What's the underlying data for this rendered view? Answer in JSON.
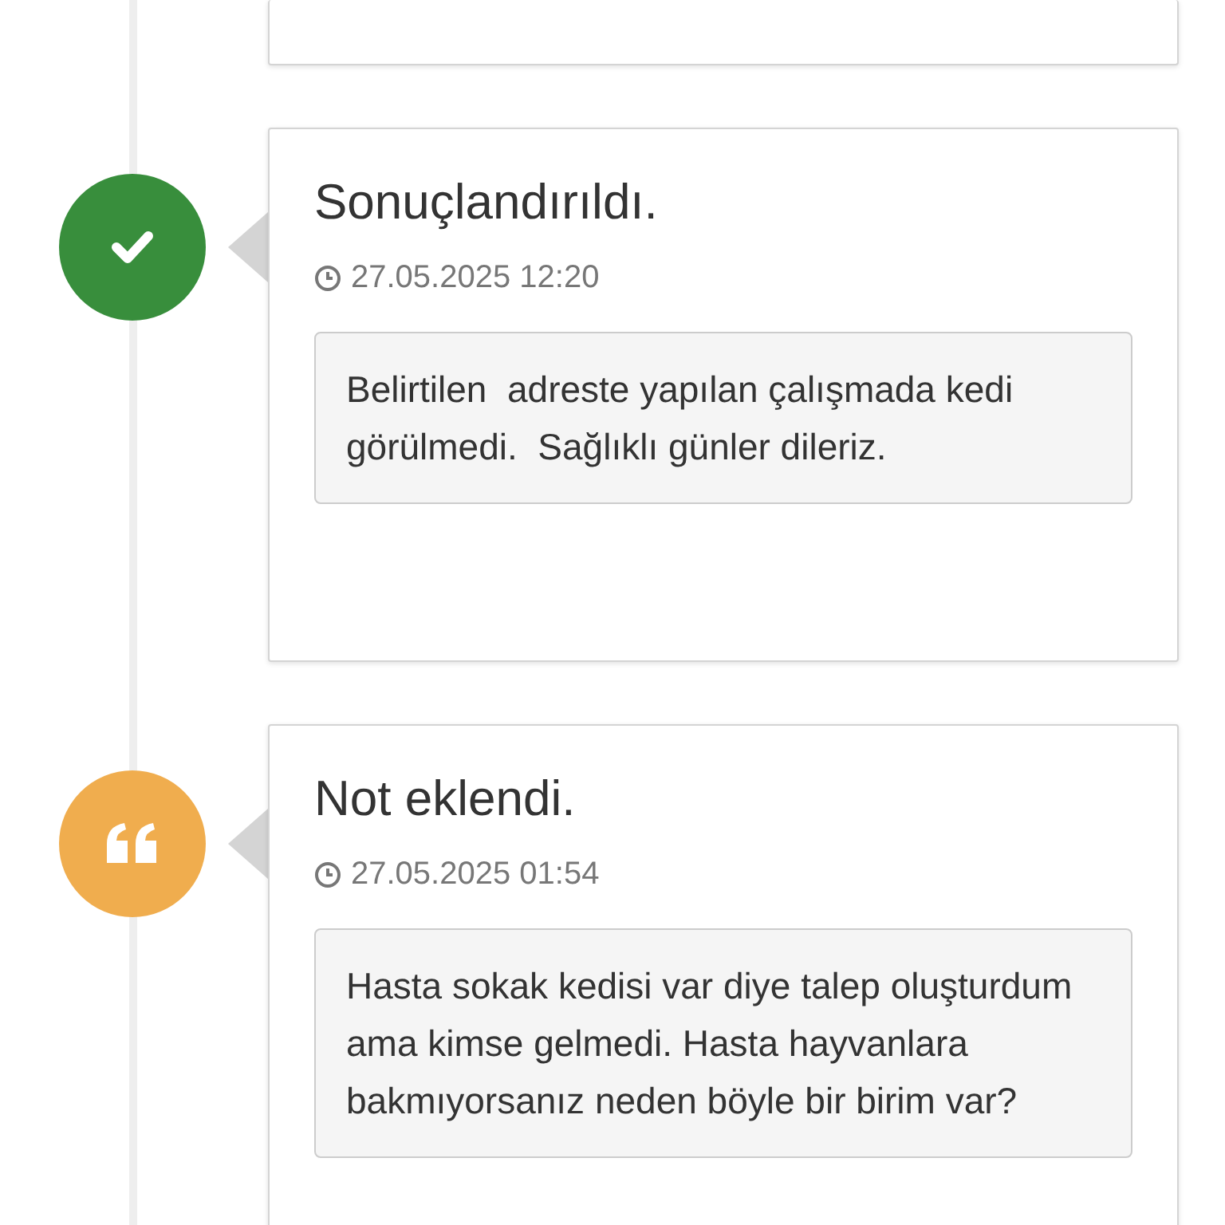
{
  "events": [
    {
      "kind": "resolved",
      "color": "#388e3c",
      "title": "Sonuçlandırıldı.",
      "time": "27.05.2025 12:20",
      "message": "Belirtilen  adreste yapılan çalışmada kedi görülmedi.  Sağlıklı günler dileriz."
    },
    {
      "kind": "note",
      "color": "#f0ad4e",
      "title": "Not eklendi.",
      "time": "27.05.2025 01:54",
      "message": "Hasta sokak kedisi var diye talep oluşturdum ama kimse gelmedi. Hasta hayvanlara bakmıyorsanız neden böyle bir birim var?"
    }
  ]
}
